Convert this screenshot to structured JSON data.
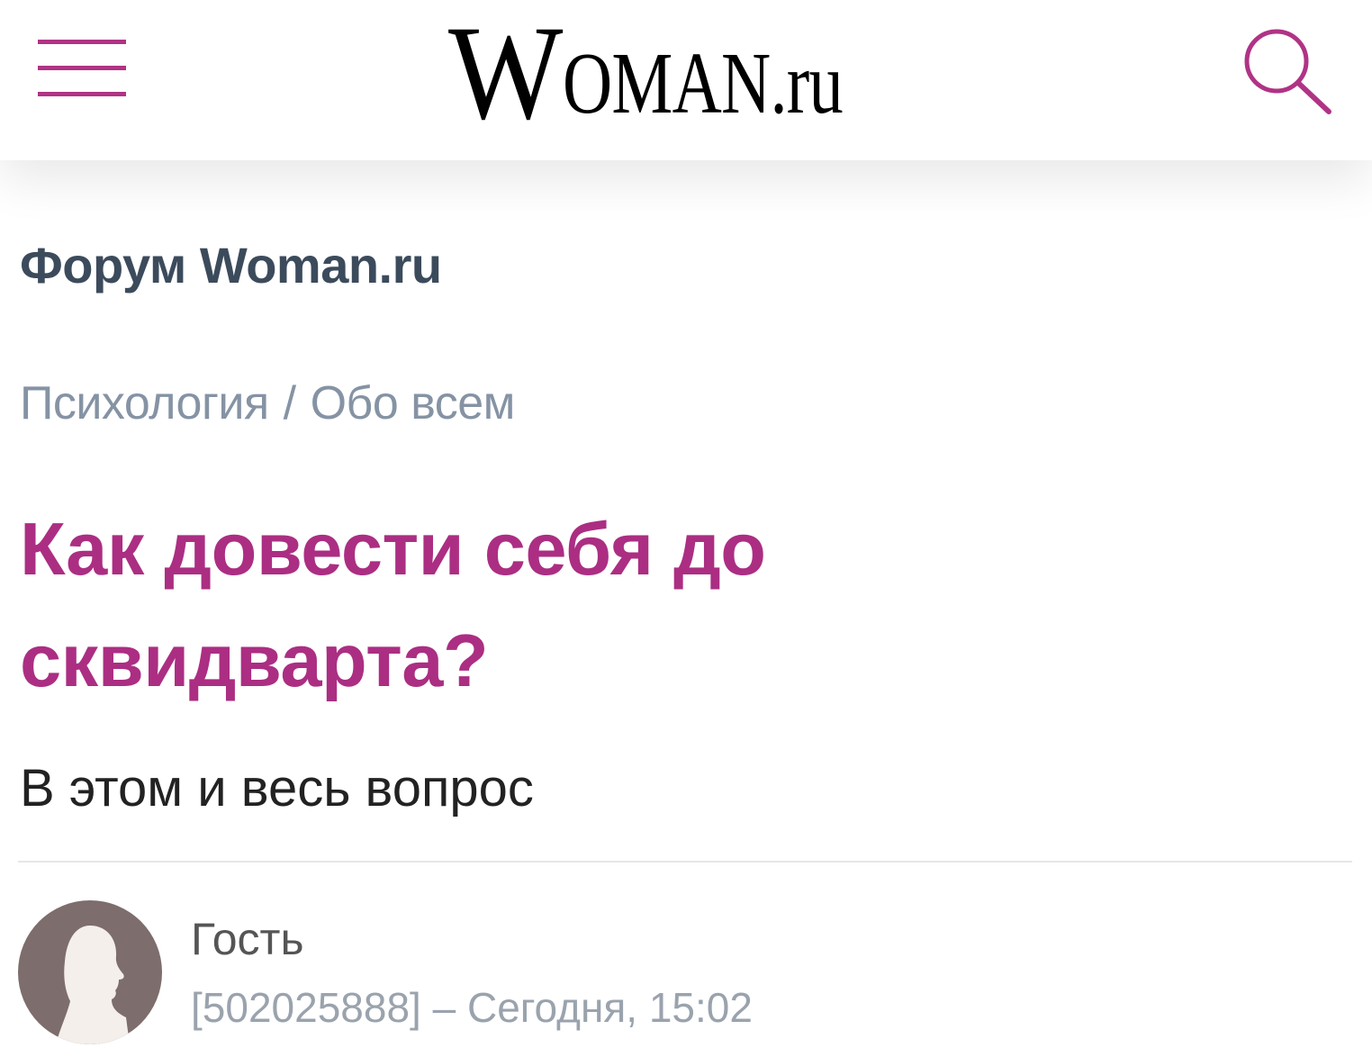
{
  "header": {
    "logo_initial": "W",
    "logo_rest": "OMAN.ru",
    "menu_icon": "hamburger-menu-icon",
    "search_icon": "magnifier-icon",
    "accent_color": "#b03385"
  },
  "forum": {
    "title": "Форум Woman.ru"
  },
  "breadcrumb": {
    "category": "Психология",
    "separator": "/",
    "subcategory": "Обо всем"
  },
  "topic": {
    "title": "Как довести себя до сквидварта?",
    "body": "В этом и весь вопрос",
    "title_color": "#ab2e83"
  },
  "post": {
    "author": "Гость",
    "author_id": "[502025888]",
    "meta_separator": "–",
    "date": "Сегодня, 15:02",
    "avatar_icon": "user-silhouette-icon"
  }
}
